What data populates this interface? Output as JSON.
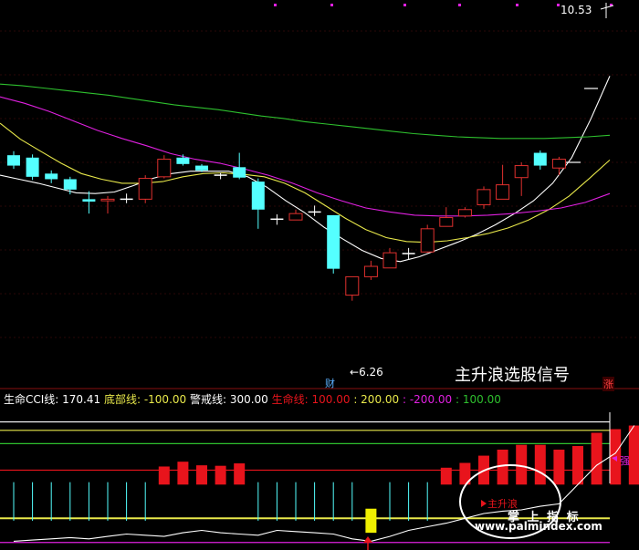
{
  "colors": {
    "up": "#e0302e",
    "down": "#54ffff",
    "cross": "#ffffff",
    "ma_white": "#ffffff",
    "ma_yellow": "#e8e84a",
    "ma_magenta": "#e020e0",
    "ma_green": "#2ec02e",
    "cci_line": "#ffffff",
    "hline_white": "#ffffff",
    "hline_yellow": "#e8e84a",
    "hline_green": "#2ec02e",
    "hline_magenta": "#e020e0",
    "bar_red": "#e8141c",
    "bar_cyan": "#54ffff",
    "bar_yellow": "#f0f000"
  },
  "labels": {
    "high_price": "10.53",
    "low_price": "6.26",
    "caption": "主升浪选股信号",
    "cai_mark": "财",
    "zhang_mark": "涨",
    "strong_mark": "强",
    "main_rise_mark": "主升浪",
    "watermark_cn": "掌 上 指 标",
    "watermark_url": "www.palmindex.com"
  },
  "legend": {
    "items": [
      {
        "text": "生命CCI线: 170.41",
        "color": "#ffffff"
      },
      {
        "text": "  底部线: -100.00",
        "color": "#e8e84a"
      },
      {
        "text": "  警戒线: 300.00",
        "color": "#ffffff"
      },
      {
        "text": "  生命线: 100.00",
        "color": "#e8141c"
      },
      {
        "text": " : 200.00",
        "color": "#e8e84a"
      },
      {
        "text": " : -200.00",
        "color": "#e020e0"
      },
      {
        "text": " : 100.00",
        "color": "#2ec02e"
      }
    ]
  },
  "chart_data": [
    {
      "type": "candlestick",
      "title": "",
      "ylim": [
        6.0,
        10.7
      ],
      "candles": [
        {
          "o": 8.85,
          "c": 8.72,
          "h": 8.9,
          "l": 8.68
        },
        {
          "o": 8.82,
          "c": 8.58,
          "h": 8.86,
          "l": 8.54
        },
        {
          "o": 8.62,
          "c": 8.55,
          "h": 8.66,
          "l": 8.5
        },
        {
          "o": 8.55,
          "c": 8.42,
          "h": 8.58,
          "l": 8.36
        },
        {
          "o": 8.3,
          "c": 8.27,
          "h": 8.4,
          "l": 8.12
        },
        {
          "o": 8.28,
          "c": 8.3,
          "h": 8.34,
          "l": 8.12
        },
        {
          "o": 8.3,
          "c": 8.3,
          "h": 8.37,
          "l": 8.25
        },
        {
          "o": 8.3,
          "c": 8.56,
          "h": 8.6,
          "l": 8.25
        },
        {
          "o": 8.58,
          "c": 8.8,
          "h": 8.85,
          "l": 8.56
        },
        {
          "o": 8.82,
          "c": 8.74,
          "h": 8.86,
          "l": 8.72
        },
        {
          "o": 8.72,
          "c": 8.66,
          "h": 8.74,
          "l": 8.64
        },
        {
          "o": 8.6,
          "c": 8.6,
          "h": 8.63,
          "l": 8.55
        },
        {
          "o": 8.7,
          "c": 8.57,
          "h": 8.88,
          "l": 8.55
        },
        {
          "o": 8.52,
          "c": 8.17,
          "h": 8.56,
          "l": 7.93
        },
        {
          "o": 8.05,
          "c": 8.05,
          "h": 8.11,
          "l": 7.98
        },
        {
          "o": 8.04,
          "c": 8.12,
          "h": 8.17,
          "l": 8.04
        },
        {
          "o": 8.14,
          "c": 8.14,
          "h": 8.22,
          "l": 8.09
        },
        {
          "o": 8.1,
          "c": 7.43,
          "h": 8.1,
          "l": 7.37
        },
        {
          "o": 7.1,
          "c": 7.33,
          "h": 7.33,
          "l": 7.03
        },
        {
          "o": 7.33,
          "c": 7.46,
          "h": 7.53,
          "l": 7.29
        },
        {
          "o": 7.44,
          "c": 7.63,
          "h": 7.69,
          "l": 7.44
        },
        {
          "o": 7.62,
          "c": 7.62,
          "h": 7.69,
          "l": 7.55
        },
        {
          "o": 7.64,
          "c": 7.93,
          "h": 7.98,
          "l": 7.63
        },
        {
          "o": 7.96,
          "c": 8.07,
          "h": 8.2,
          "l": 7.96
        },
        {
          "o": 8.09,
          "c": 8.17,
          "h": 8.2,
          "l": 8.07
        },
        {
          "o": 8.23,
          "c": 8.42,
          "h": 8.46,
          "l": 8.18
        },
        {
          "o": 8.3,
          "c": 8.48,
          "h": 8.73,
          "l": 8.3
        },
        {
          "o": 8.57,
          "c": 8.72,
          "h": 8.76,
          "l": 8.34
        },
        {
          "o": 8.88,
          "c": 8.72,
          "h": 8.91,
          "l": 8.67
        },
        {
          "o": 8.69,
          "c": 8.8,
          "h": 8.83,
          "l": 8.6
        }
      ],
      "ma_lines": [
        {
          "name": "MA5",
          "color": "#ffffff",
          "values": [
            8.6,
            8.55,
            8.5,
            8.44,
            8.38,
            8.37,
            8.39,
            8.47,
            8.56,
            8.62,
            8.65,
            8.65,
            8.65,
            8.58,
            8.45,
            8.28,
            8.13,
            7.95,
            7.8,
            7.66,
            7.56,
            7.52,
            7.58,
            7.67,
            7.76,
            7.86,
            7.98,
            8.12,
            8.28,
            8.5,
            8.82,
            9.3,
            9.84
          ]
        },
        {
          "name": "MA10",
          "color": "#e8e84a",
          "values": [
            9.25,
            9.05,
            8.9,
            8.75,
            8.62,
            8.55,
            8.5,
            8.5,
            8.52,
            8.58,
            8.62,
            8.63,
            8.61,
            8.58,
            8.5,
            8.38,
            8.22,
            8.06,
            7.92,
            7.82,
            7.77,
            7.76,
            7.78,
            7.82,
            7.87,
            7.94,
            8.04,
            8.17,
            8.34,
            8.56,
            8.79
          ]
        },
        {
          "name": "MA20",
          "color": "#e020e0",
          "values": [
            9.58,
            9.5,
            9.4,
            9.28,
            9.16,
            9.06,
            8.97,
            8.87,
            8.8,
            8.75,
            8.68,
            8.6,
            8.5,
            8.38,
            8.28,
            8.19,
            8.14,
            8.1,
            8.09,
            8.09,
            8.1,
            8.12,
            8.15,
            8.19,
            8.26,
            8.37
          ]
        },
        {
          "name": "MA60",
          "color": "#2ec02e",
          "values": [
            9.74,
            9.72,
            9.69,
            9.66,
            9.63,
            9.6,
            9.56,
            9.52,
            9.48,
            9.45,
            9.42,
            9.38,
            9.34,
            9.31,
            9.27,
            9.24,
            9.21,
            9.18,
            9.15,
            9.12,
            9.1,
            9.08,
            9.07,
            9.06,
            9.06,
            9.06,
            9.07,
            9.08,
            9.1
          ]
        }
      ],
      "annotations": [
        {
          "text": "10.53",
          "value": 10.53
        },
        {
          "text": "6.26",
          "value": 6.26
        }
      ]
    },
    {
      "type": "bar",
      "title": "生命CCI线",
      "ylim": [
        -220,
        340
      ],
      "hlines": [
        {
          "value": 300,
          "color": "#ffffff"
        },
        {
          "value": 265,
          "color": "#e8e84a"
        },
        {
          "value": 210,
          "color": "#2ec02e"
        },
        {
          "value": 100,
          "color": "#e8141c"
        },
        {
          "value": -100,
          "color": "#e8e84a"
        },
        {
          "value": -200,
          "color": "#e020e0"
        }
      ],
      "bars": [
        {
          "value": 0,
          "color": "cyan"
        },
        {
          "value": 0,
          "color": "cyan"
        },
        {
          "value": 0,
          "color": "cyan"
        },
        {
          "value": 0,
          "color": "cyan"
        },
        {
          "value": 0,
          "color": "cyan"
        },
        {
          "value": 0,
          "color": "cyan"
        },
        {
          "value": 0,
          "color": "cyan"
        },
        {
          "value": 0,
          "color": "cyan"
        },
        {
          "value": 115,
          "color": "red"
        },
        {
          "value": 135,
          "color": "red"
        },
        {
          "value": 120,
          "color": "red"
        },
        {
          "value": 118,
          "color": "red"
        },
        {
          "value": 128,
          "color": "red"
        },
        {
          "value": 0,
          "color": "cyan"
        },
        {
          "value": 0,
          "color": "cyan"
        },
        {
          "value": 0,
          "color": "cyan"
        },
        {
          "value": 0,
          "color": "cyan"
        },
        {
          "value": 0,
          "color": "cyan"
        },
        {
          "value": 0,
          "color": "cyan"
        },
        {
          "value": -110,
          "color": "yellow"
        },
        {
          "value": 0,
          "color": "cyan"
        },
        {
          "value": 0,
          "color": "cyan"
        },
        {
          "value": 0,
          "color": "cyan"
        },
        {
          "value": 110,
          "color": "red"
        },
        {
          "value": 130,
          "color": "red"
        },
        {
          "value": 160,
          "color": "red"
        },
        {
          "value": 185,
          "color": "red"
        },
        {
          "value": 205,
          "color": "red"
        },
        {
          "value": 205,
          "color": "red"
        },
        {
          "value": 185,
          "color": "red"
        },
        {
          "value": 200,
          "color": "red"
        },
        {
          "value": 255,
          "color": "red"
        },
        {
          "value": 270,
          "color": "red"
        },
        {
          "value": 285,
          "color": "red"
        }
      ],
      "cci_line": [
        -195,
        -190,
        -185,
        -180,
        -185,
        -175,
        -165,
        -170,
        -175,
        -160,
        -150,
        -160,
        -165,
        -170,
        -150,
        -155,
        -160,
        -165,
        -185,
        -195,
        -175,
        -150,
        -135,
        -120,
        -100,
        -80,
        -70,
        -65,
        -50,
        -40,
        40,
        120,
        170,
        285
      ]
    }
  ]
}
